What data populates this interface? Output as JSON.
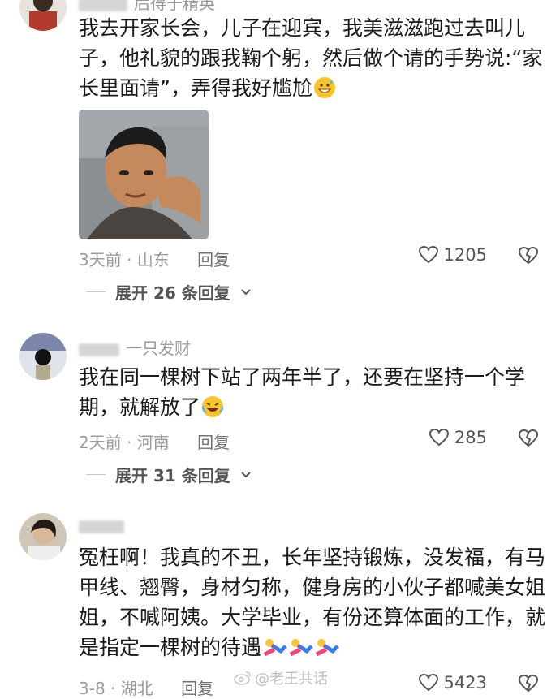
{
  "comments": [
    {
      "username": "后得于精英",
      "text": "我去开家长会，儿子在迎宾，我美滋滋跑过去叫儿子，他礼貌的跟我鞠个躬，然后做个请的手势说:“家长里面请”，弄得我好尴尬",
      "emoji": "grinning-sweat-emoji",
      "time_location": "3天前 · 山东",
      "reply_label": "回复",
      "likes": "1205",
      "expand_label": "展开 26 条回复"
    },
    {
      "username": "一只发财",
      "text": "我在同一棵树下站了两年半了，还要在坚持一个学期，就解放了",
      "emoji": "crying-laughing-emoji",
      "time_location": "2天前 · 河南",
      "reply_label": "回复",
      "likes": "285",
      "expand_label": "展开 31 条回复"
    },
    {
      "username": "",
      "text": "冤枉啊！我真的不丑，长年坚持锻炼，没发福，有马甲线、翘臀，身材匀称，健身房的小伙子都喊美女姐姐，不喊阿姨。大学毕业，有份还算体面的工作，就是指定一棵树的待遇",
      "emoji": "falling-person-emoji",
      "time_location": "3-8 · 湖北",
      "reply_label": "回复",
      "likes": "5423"
    }
  ],
  "watermark": "@老王共话",
  "colors": {
    "meta": "#9b9b9b",
    "text": "#1a1a1a"
  }
}
